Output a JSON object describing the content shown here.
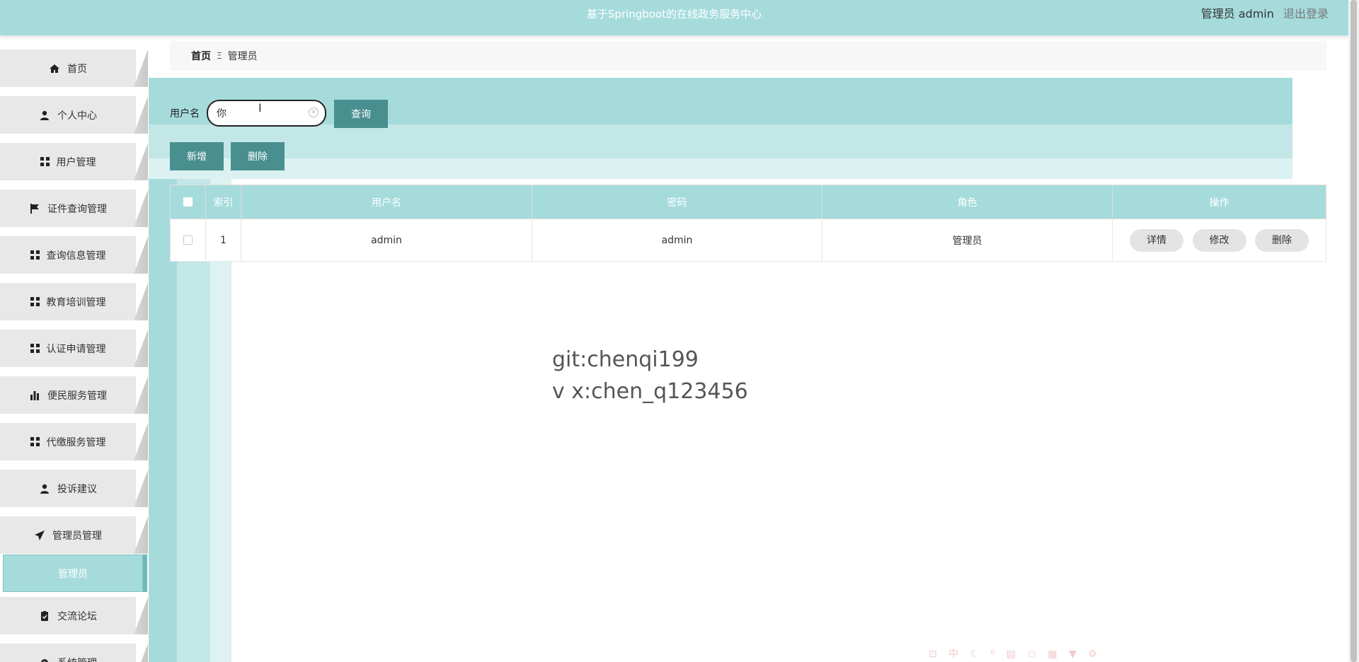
{
  "header": {
    "app_title": "基于Springboot的在线政务服务中心",
    "user_text": "管理员 admin",
    "logout_label": "退出登录"
  },
  "sidebar": {
    "items": [
      {
        "label": "首页",
        "icon": "home-icon"
      },
      {
        "label": "个人中心",
        "icon": "user-icon"
      },
      {
        "label": "用户管理",
        "icon": "grid-icon"
      },
      {
        "label": "证件查询管理",
        "icon": "flag-icon"
      },
      {
        "label": "查询信息管理",
        "icon": "grid-icon"
      },
      {
        "label": "教育培训管理",
        "icon": "grid-icon"
      },
      {
        "label": "认证申请管理",
        "icon": "grid-icon"
      },
      {
        "label": "便民服务管理",
        "icon": "bar-chart-icon"
      },
      {
        "label": "代缴服务管理",
        "icon": "grid-icon"
      },
      {
        "label": "投诉建议",
        "icon": "user-icon"
      },
      {
        "label": "管理员管理",
        "icon": "send-icon"
      },
      {
        "label": "交流论坛",
        "icon": "clipboard-icon"
      },
      {
        "label": "系统管理",
        "icon": "gear-icon"
      }
    ],
    "active_submenu": "管理员"
  },
  "breadcrumb": {
    "home": "首页",
    "separator": "Ξ",
    "current": "管理员"
  },
  "search": {
    "label": "用户名",
    "value": "你",
    "query_label": "查询"
  },
  "actions": {
    "add_label": "新增",
    "delete_label": "删除"
  },
  "table": {
    "columns": [
      "索引",
      "用户名",
      "密码",
      "角色",
      "操作"
    ],
    "rows": [
      {
        "index": "1",
        "username": "admin",
        "password": "admin",
        "role": "管理员"
      }
    ],
    "row_actions": {
      "detail": "详情",
      "edit": "修改",
      "delete": "删除"
    }
  },
  "watermark": {
    "line1": "git:chenqi199",
    "line2": "v x:chen_q123456"
  },
  "colors": {
    "header_bg": "#a6dbdc",
    "button_bg": "#4a8f90",
    "menu_bg": "#e8e8e8"
  }
}
